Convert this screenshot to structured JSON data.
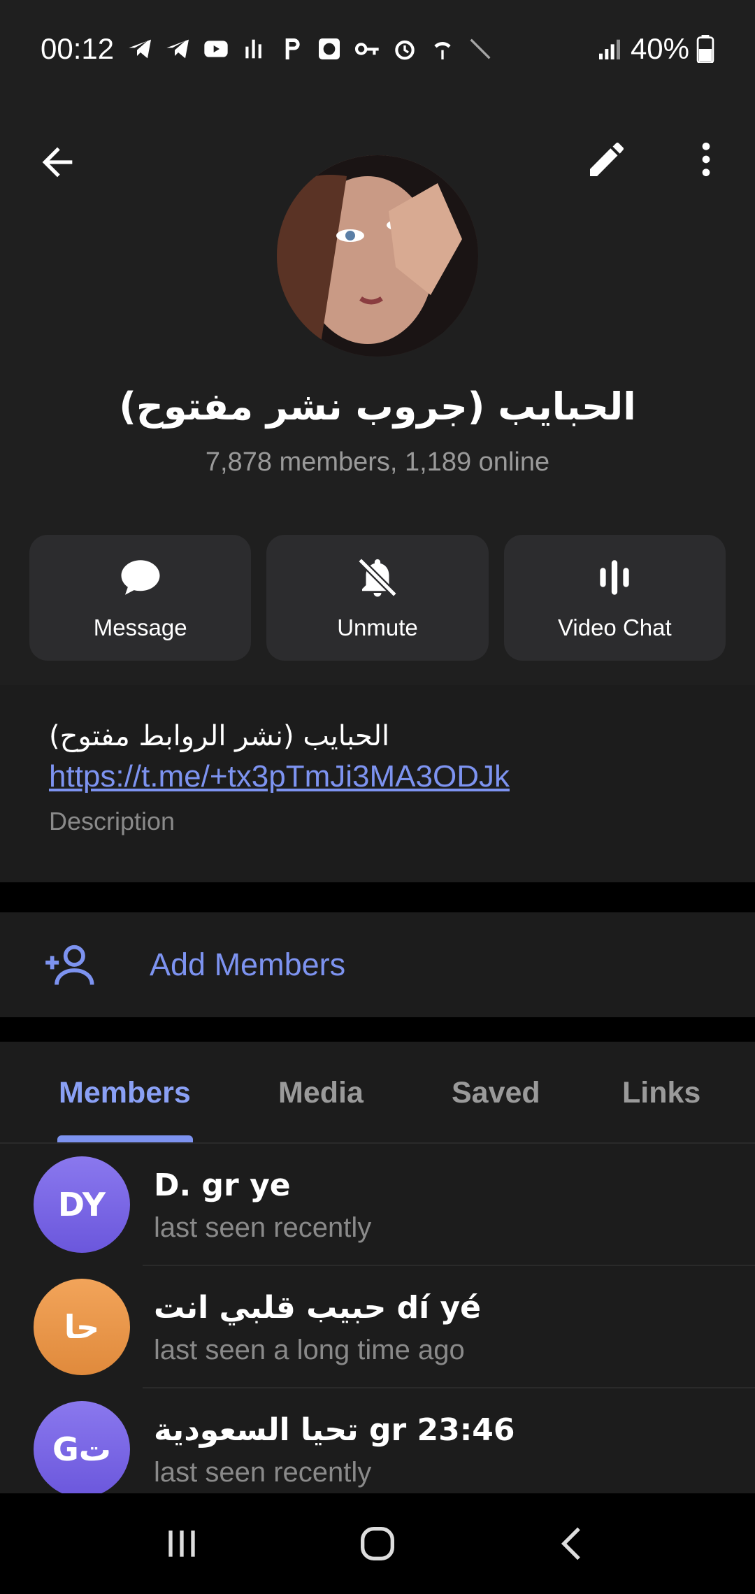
{
  "status_bar": {
    "time": "00:12",
    "battery": "40%"
  },
  "header": {
    "back_icon": "arrow-left-icon",
    "edit_icon": "pencil-icon",
    "more_icon": "more-vert-icon",
    "title": "الحبايب (جروب نشر مفتوح)",
    "subtitle": "7,878 members, 1,189 online"
  },
  "actions": [
    {
      "label": "Message",
      "icon": "message-bubble-icon"
    },
    {
      "label": "Unmute",
      "icon": "bell-off-icon"
    },
    {
      "label": "Video Chat",
      "icon": "voice-chat-icon"
    }
  ],
  "description": {
    "text": "الحبايب  (نشر الروابط مفتوح)",
    "link": "https://t.me/+tx3pTmJi3MA3ODJk",
    "label": "Description"
  },
  "add_members": {
    "label": "Add Members",
    "icon": "add-person-icon"
  },
  "tabs": [
    {
      "label": "Members",
      "active": true
    },
    {
      "label": "Media",
      "active": false
    },
    {
      "label": "Saved",
      "active": false
    },
    {
      "label": "Links",
      "active": false
    }
  ],
  "members": [
    {
      "initials": "DY",
      "name": "D. gr ye",
      "status": "last seen recently",
      "avatar_color": "#7a67e6"
    },
    {
      "initials": "حا",
      "name": "حبيب قلبي انت dí yé",
      "status": "last seen a long time ago",
      "avatar_color": "#e89448"
    },
    {
      "initials": "Gت",
      "name": "تحيا السعودية gr 23:46",
      "status": "last seen recently",
      "avatar_color": "#7a67e6"
    }
  ],
  "colors": {
    "accent": "#7d93f0",
    "background": "#1c1c1c",
    "button_bg": "#2c2c2e"
  }
}
